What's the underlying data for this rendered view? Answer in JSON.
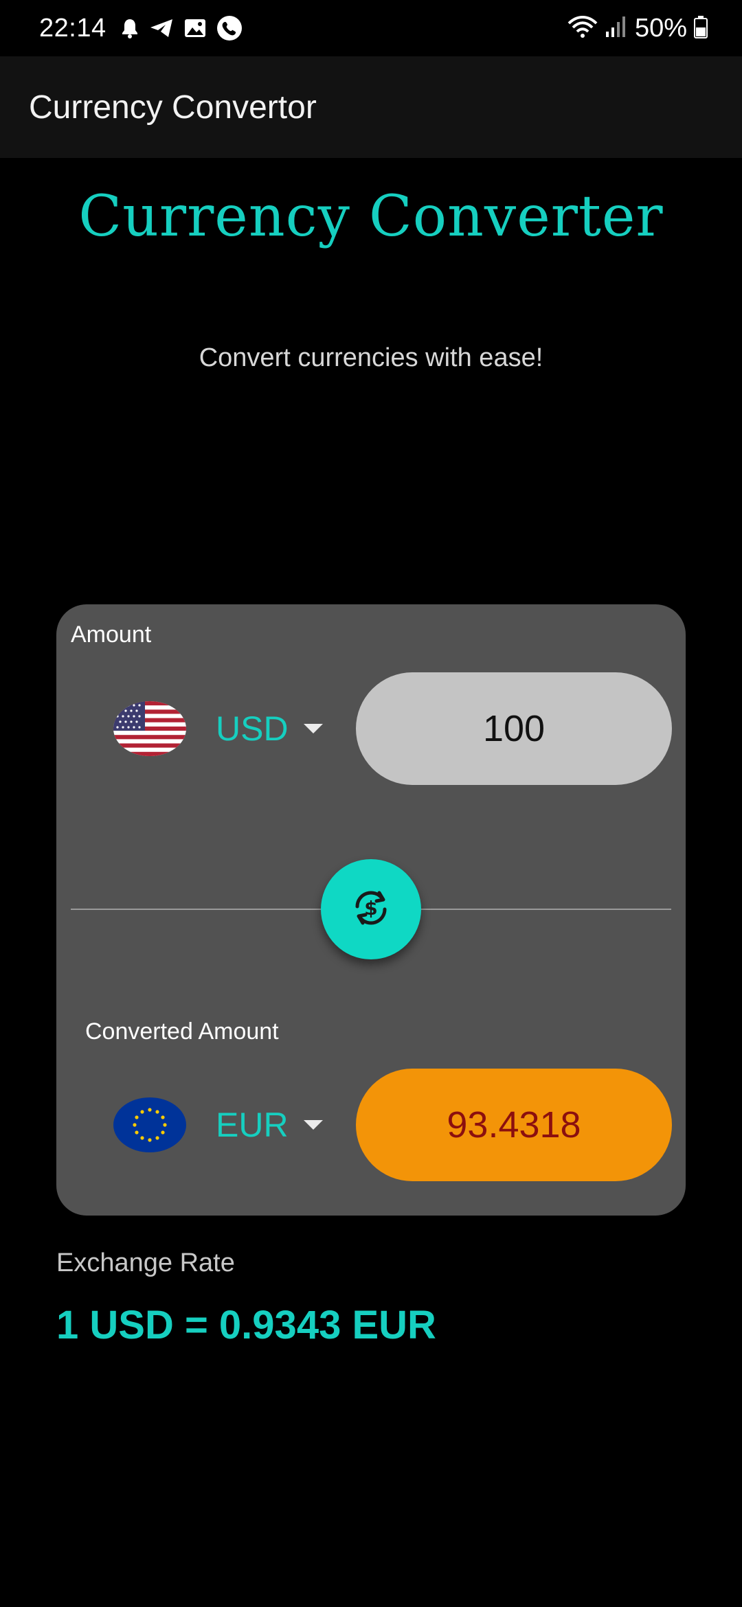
{
  "status_bar": {
    "time": "22:14",
    "left_icons": [
      "notification-bell-icon",
      "telegram-icon",
      "gallery-icon",
      "phone-call-icon"
    ],
    "right_icons": [
      "wifi-icon",
      "signal-icon",
      "battery-icon"
    ],
    "battery": "50%"
  },
  "app_bar": {
    "title": "Currency Convertor"
  },
  "header": {
    "title": "Currency Converter",
    "subtitle": "Convert currencies with ease!"
  },
  "converter": {
    "amount_label": "Amount",
    "from": {
      "currency": "USD",
      "flag": "us-flag-icon",
      "value": "100"
    },
    "swap_icon": "currency-swap-icon",
    "converted_label": "Converted Amount",
    "to": {
      "currency": "EUR",
      "flag": "eu-flag-icon",
      "value": "93.4318"
    }
  },
  "exchange_rate": {
    "label": "Exchange Rate",
    "value": "1 USD = 0.9343 EUR"
  },
  "colors": {
    "accent": "#16cfc0",
    "card": "#525252",
    "amount_pill": "#c4c4c4",
    "converted_pill": "#f39408",
    "converted_text": "#8b0f0f"
  }
}
